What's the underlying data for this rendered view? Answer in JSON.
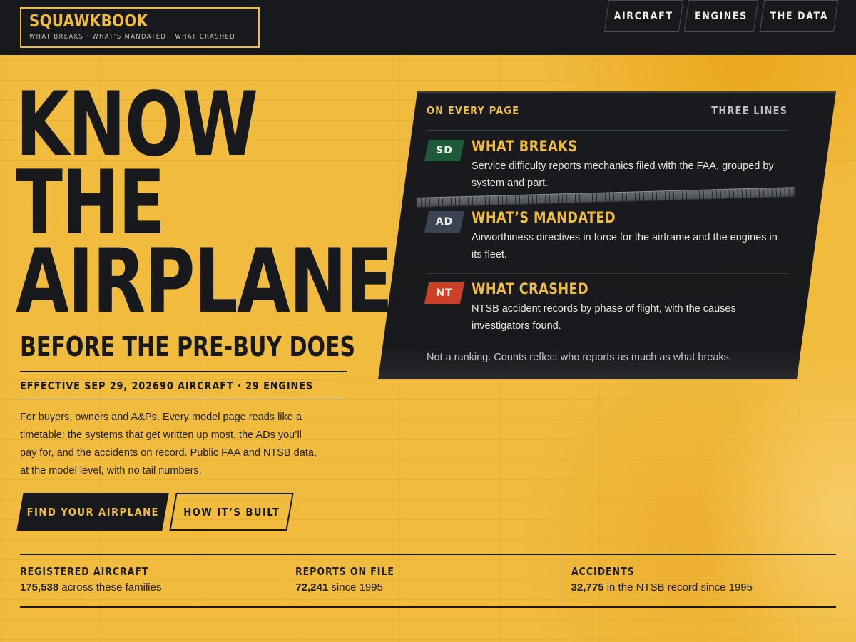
{
  "brand": {
    "name": "SQUAWKBOOK",
    "tagline": "WHAT BREAKS · WHAT’S MANDATED · WHAT CRASHED"
  },
  "nav": [
    "AIRCRAFT",
    "ENGINES",
    "THE DATA"
  ],
  "hero": {
    "title_lines": [
      "KNOW",
      "THE",
      "AIRPLANE"
    ],
    "subtitle": "BEFORE THE PRE-BUY DOES",
    "effective": "EFFECTIVE SEP 29, 2026",
    "coverage": "90 AIRCRAFT · 29 ENGINES",
    "intro": "For buyers, owners and A&Ps. Every model page reads like a timetable: the systems that get written up most, the ADs you’ll pay for, and the accidents on record. Public FAA and NTSB data, at the model level, with no tail numbers."
  },
  "buttons": {
    "primary": "FIND YOUR AIRPLANE",
    "secondary": "HOW IT’S BUILT"
  },
  "card": {
    "kicker": "ON EVERY PAGE",
    "count": "THREE LINES",
    "rows": [
      {
        "code": "SD",
        "title": "WHAT BREAKS",
        "desc": "Service difficulty reports mechanics filed with the FAA, grouped by system and part.",
        "color": "#1e5b3a"
      },
      {
        "code": "AD",
        "title": "WHAT’S MANDATED",
        "desc": "Airworthiness directives in force for the airframe and the engines in its fleet.",
        "color": "#3b4552"
      },
      {
        "code": "NT",
        "title": "WHAT CRASHED",
        "desc": "NTSB accident records by phase of flight, with the causes investigators found.",
        "color": "#cc4027"
      }
    ],
    "footnote": "Not a ranking. Counts reflect who reports as much as what breaks."
  },
  "stats": [
    {
      "label": "REGISTERED AIRCRAFT",
      "value": "175,538",
      "suffix": " across these families"
    },
    {
      "label": "REPORTS ON FILE",
      "value": "72,241",
      "suffix": " since 1995"
    },
    {
      "label": "ACCIDENTS",
      "value": "32,775",
      "suffix": " in the NTSB record since 1995"
    }
  ],
  "colors": {
    "accent": "#f1bb3e",
    "ink": "#17191c"
  }
}
